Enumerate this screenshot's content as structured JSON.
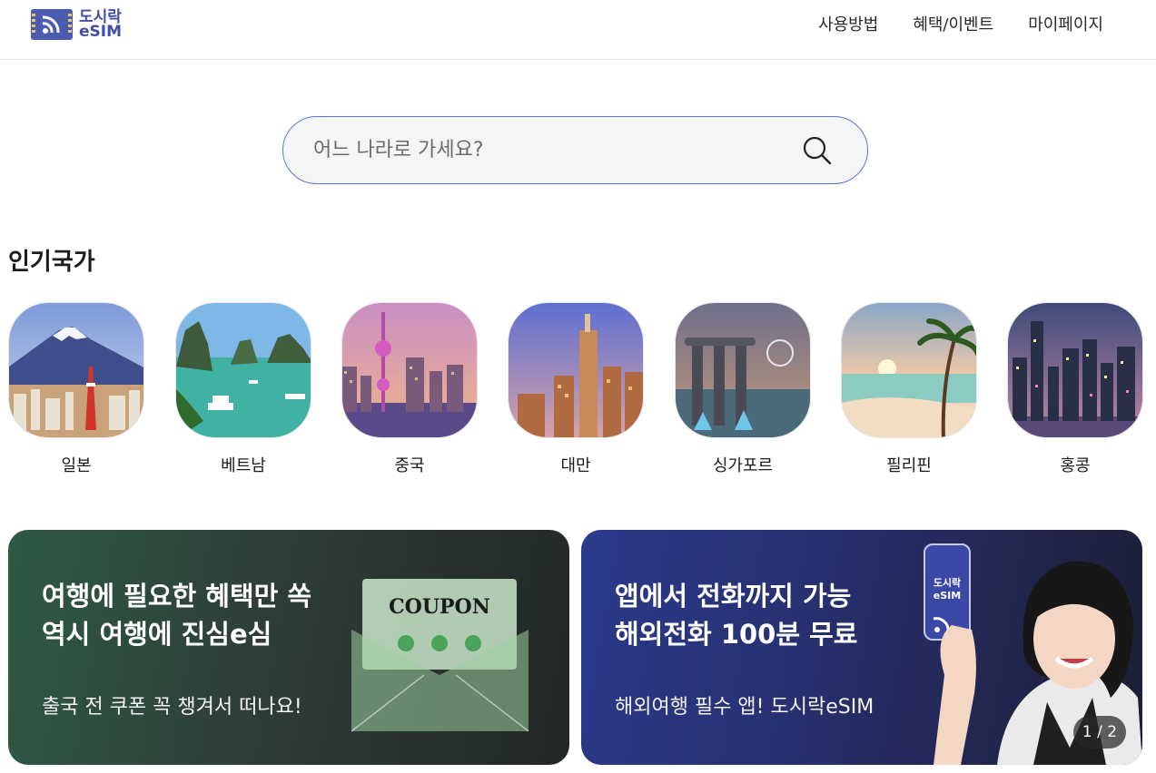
{
  "header": {
    "logo_line1": "도시락",
    "logo_line2": "eSIM",
    "nav": [
      "사용방법",
      "혜택/이벤트",
      "마이페이지"
    ]
  },
  "search": {
    "placeholder": "어느 나라로 가세요?",
    "icon": "search-icon"
  },
  "popular": {
    "title": "인기국가",
    "countries": [
      "일본",
      "베트남",
      "중국",
      "대만",
      "싱가포르",
      "필리핀",
      "홍콩"
    ]
  },
  "banners": [
    {
      "headline": "여행에 필요한 혜택만 쏙\n역시 여행에 진심e심",
      "sub": "출국 전 쿠폰 꼭 챙겨서 떠나요!",
      "art_text": "COUPON",
      "art_icon": "envelope-coupon-icon"
    },
    {
      "headline": "앱에서 전화까지 가능\n해외전화 100분 무료",
      "sub": "해외여행 필수 앱! 도시락eSIM",
      "phone_text_line1": "도시락",
      "phone_text_line2": "eSIM",
      "pager": "1 / 2"
    }
  ],
  "colors": {
    "brand": "#3f4ea8",
    "search_border": "#5a75d8",
    "banner_green": "#2f5a45",
    "banner_blue": "#2b3a8c"
  }
}
